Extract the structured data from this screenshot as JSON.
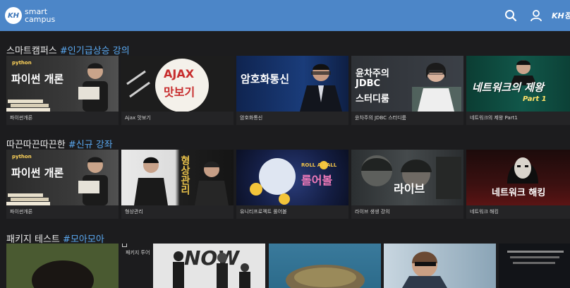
{
  "header": {
    "logo_badge": "KH",
    "logo_line1": "smart",
    "logo_line2": "campus",
    "right_logo": "KH정보"
  },
  "sections": [
    {
      "title": "스마트캠퍼스",
      "tag": "#인기급상승 강의"
    },
    {
      "title": "따끈따끈따끈한",
      "tag": "#신규 강좌"
    },
    {
      "title": "패키지 테스트",
      "tag": "#모아모아"
    }
  ],
  "popular": [
    {
      "label": "파이썬개론",
      "thumb_text": "파이썬 개론",
      "thumb_sub": "python"
    },
    {
      "label": "Ajax 맛보기",
      "thumb_text": "AJAX",
      "thumb_sub": "맛보기"
    },
    {
      "label": "암호화통신",
      "thumb_text": "암호화통신"
    },
    {
      "label": "윤차주의 JDBC 스터디룸",
      "thumb_text": "윤차주의",
      "thumb_sub": "JDBC",
      "thumb_sub2": "스터디룸"
    },
    {
      "label": "네트워크의 제왕 Part1",
      "thumb_text": "네트워크의 제왕",
      "thumb_sub": "Part 1"
    }
  ],
  "newest": [
    {
      "label": "파이썬개론",
      "thumb_text": "파이썬 개론",
      "thumb_sub": "python"
    },
    {
      "label": "형상관리",
      "thumb_text": "형상관리"
    },
    {
      "label": "유니티프로젝트 롤어볼",
      "thumb_text": "롤어볼",
      "thumb_sub": "ROLL A BALL"
    },
    {
      "label": "라이브 생생 강의",
      "thumb_text": "라이브"
    },
    {
      "label": "네트워크 해킹",
      "thumb_text": "네트워크 해킹"
    }
  ],
  "packages": [
    {
      "label": "패키지 투어"
    },
    {
      "thumb_text": "NOW"
    }
  ],
  "colors": {
    "header": "#4c86c8",
    "accent": "#5aa8f0",
    "background": "#1c1c1e"
  }
}
